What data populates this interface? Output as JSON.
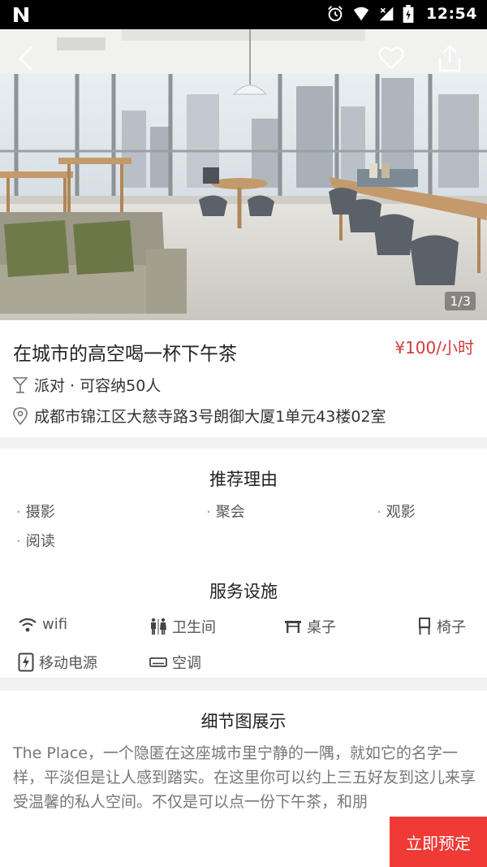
{
  "status_bar": {
    "time": "12:54"
  },
  "gallery": {
    "counter": "1/3"
  },
  "venue": {
    "title": "在城市的高空喝一杯下午茶",
    "price": "¥100/小时",
    "type_capacity": "派对 · 可容纳50人",
    "address": "成都市锦江区大慈寺路3号朗御大厦1单元43楼02室"
  },
  "reasons": {
    "title": "推荐理由",
    "items": [
      "摄影",
      "聚会",
      "观影",
      "阅读"
    ]
  },
  "facilities": {
    "title": "服务设施",
    "items": [
      {
        "label": "wifi",
        "icon": "wifi-icon"
      },
      {
        "label": "卫生间",
        "icon": "restroom-icon"
      },
      {
        "label": "桌子",
        "icon": "table-icon"
      },
      {
        "label": "椅子",
        "icon": "chair-icon"
      },
      {
        "label": "移动电源",
        "icon": "power-bank-icon"
      },
      {
        "label": "空调",
        "icon": "air-conditioner-icon"
      }
    ]
  },
  "details": {
    "title": "细节图展示",
    "text": "The Place，一个隐匿在这座城市里宁静的一隅，就如它的名字一样，平淡但是让人感到踏实。在这里你可以约上三五好友到这儿来享受温馨的私人空间。不仅是可以点一份下午茶，和朋"
  },
  "actions": {
    "book": "立即预定"
  },
  "colors": {
    "accent": "#ef3a35",
    "price": "#d23b3b"
  }
}
